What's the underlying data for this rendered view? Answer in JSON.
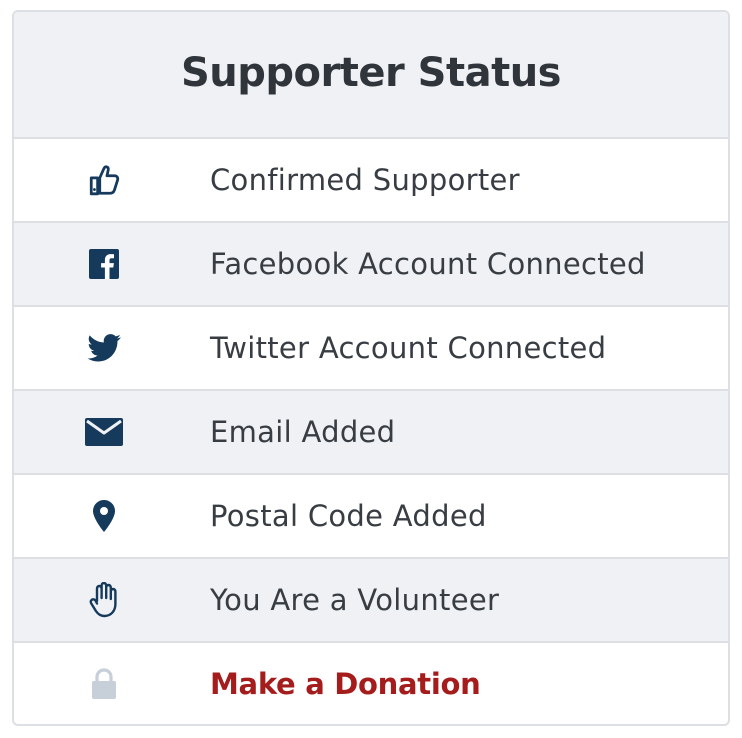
{
  "card": {
    "title": "Supporter Status"
  },
  "items": [
    {
      "label": "Confirmed Supporter",
      "icon": "thumbs-up-icon"
    },
    {
      "label": "Facebook Account Connected",
      "icon": "facebook-icon"
    },
    {
      "label": "Twitter Account Connected",
      "icon": "twitter-icon"
    },
    {
      "label": "Email Added",
      "icon": "envelope-icon"
    },
    {
      "label": "Postal Code Added",
      "icon": "map-pin-icon"
    },
    {
      "label": "You Are a Volunteer",
      "icon": "raised-hand-icon"
    },
    {
      "label": "Make a Donation",
      "icon": "lock-icon"
    }
  ],
  "colors": {
    "icon": "#153a5c",
    "lock_icon": "#c7cfd8",
    "donate": "#a51c1c",
    "text": "#383d43",
    "title": "#2f353b",
    "alt_row": "#eff1f4",
    "border": "#dcdfe4"
  }
}
